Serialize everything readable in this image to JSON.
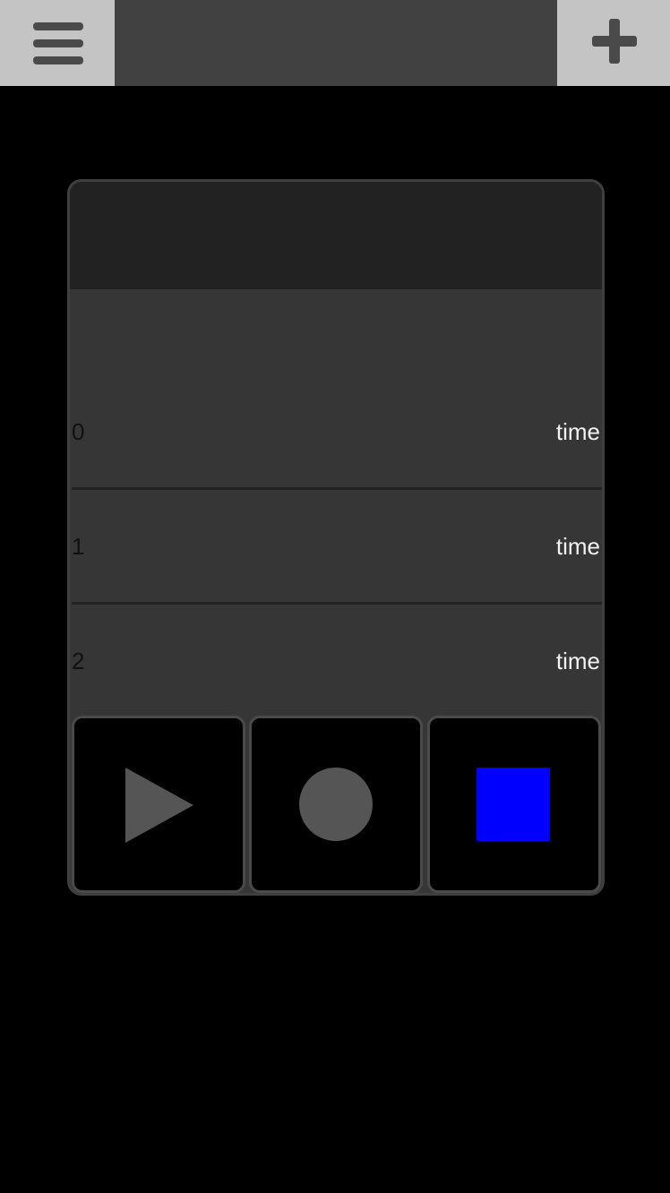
{
  "topbar": {
    "menu_icon": "hamburger-icon",
    "add_icon": "plus-icon"
  },
  "list": {
    "rows": [
      {
        "index": "0",
        "time": "time"
      },
      {
        "index": "1",
        "time": "time"
      },
      {
        "index": "2",
        "time": "time"
      }
    ]
  },
  "controls": {
    "play_icon": "play-icon",
    "record_icon": "record-icon",
    "stop_icon": "stop-icon"
  },
  "colors": {
    "background": "#000000",
    "topbar": "#414141",
    "topbar_button": "#c4c4c4",
    "panel": "#363636",
    "panel_header": "#222222",
    "icon_gray": "#555555",
    "stop_active": "#0000ff"
  }
}
